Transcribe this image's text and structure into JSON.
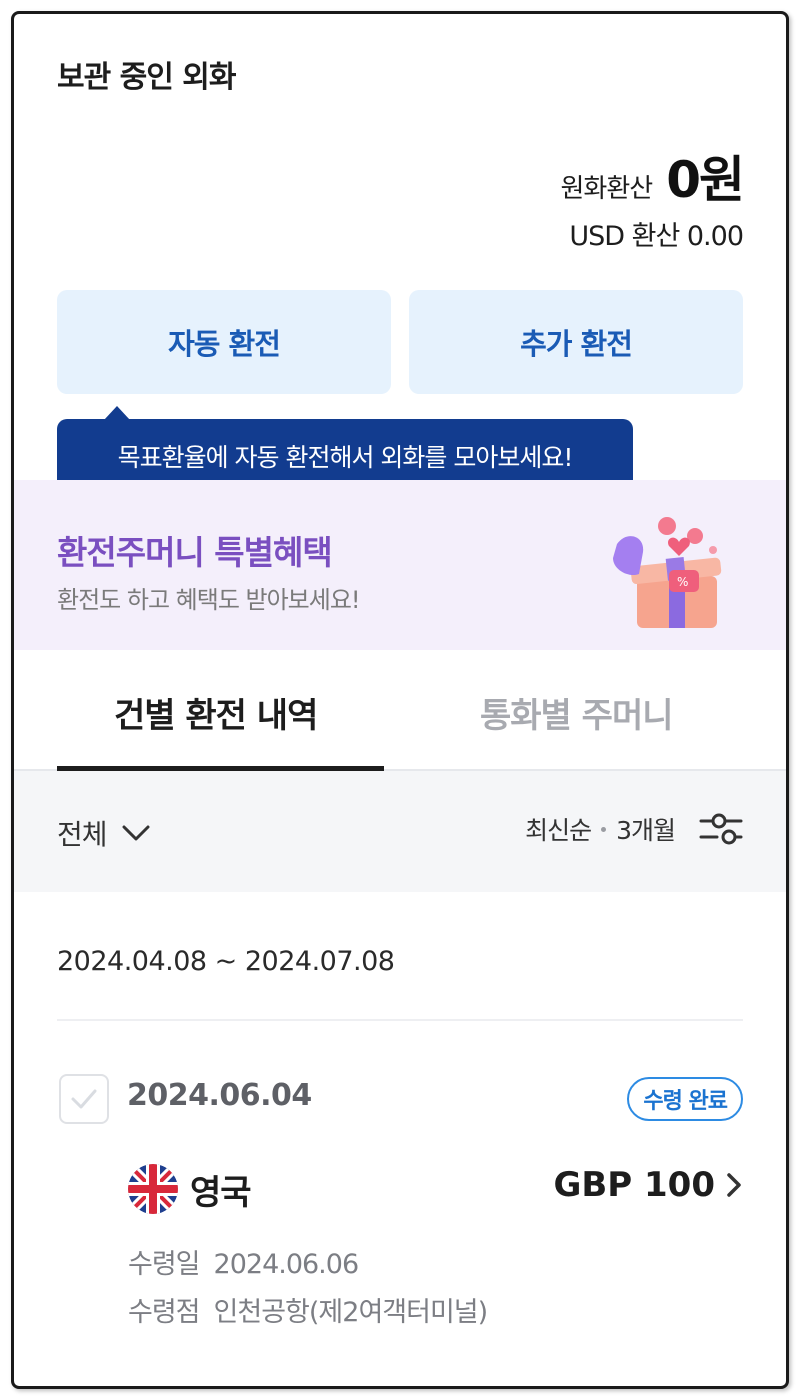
{
  "header": {
    "title": "보관 중인 외화",
    "krw_label": "원화환산",
    "krw_value": "0원",
    "usd_text": "USD 환산 0.00"
  },
  "actions": {
    "auto_exchange": "자동 환전",
    "add_exchange": "추가 환전"
  },
  "tooltip": {
    "text": "목표환율에 자동 환전해서 외화를 모아보세요!"
  },
  "promo": {
    "title": "환전주머니 특별혜택",
    "subtitle": "환전도 하고 혜택도 받아보세요!",
    "image_icon": "gift-box-icon"
  },
  "tabs": [
    {
      "label": "건별 환전 내역",
      "active": true
    },
    {
      "label": "통화별 주머니",
      "active": false
    }
  ],
  "filter": {
    "type_label": "전체",
    "sort_label": "최신순",
    "period_label": "3개월"
  },
  "date_range": "2024.04.08 ~ 2024.07.08",
  "transactions": [
    {
      "date": "2024.06.04",
      "status": "수령 완료",
      "country": "영국",
      "amount": "GBP 100",
      "receive_date_label": "수령일",
      "receive_date": "2024.06.06",
      "receive_place_label": "수령점",
      "receive_place": "인천공항(제2여객터미널)"
    }
  ],
  "colors": {
    "accent_blue": "#1a5bb5",
    "tooltip_bg": "#123c8f",
    "promo_purple": "#7a4fc0",
    "badge_blue": "#2d8be3"
  }
}
